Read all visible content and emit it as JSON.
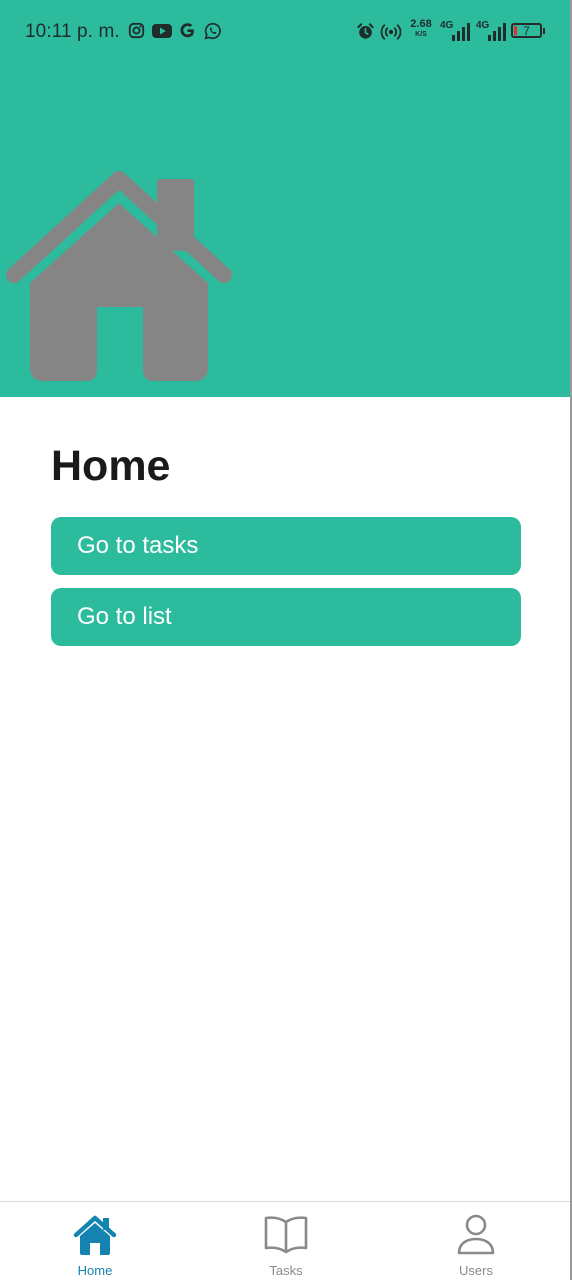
{
  "colors": {
    "accent": "#2dbb9e",
    "active_tab": "#1583b0",
    "inactive_tab": "#8a8a8a",
    "hero_icon": "#858585"
  },
  "status_bar": {
    "time": "10:11 p. m.",
    "left_icons": [
      "instagram-icon",
      "youtube-icon",
      "google-icon",
      "whatsapp-icon"
    ],
    "net_speed": "2.68",
    "net_speed_unit": "K/S",
    "network_1": "4G",
    "network_2": "4G",
    "battery_level": "7"
  },
  "hero": {
    "icon": "house-icon"
  },
  "main": {
    "title": "Home",
    "buttons": [
      {
        "label": "Go to tasks"
      },
      {
        "label": "Go to list"
      }
    ]
  },
  "bottom_nav": {
    "tabs": [
      {
        "label": "Home",
        "icon": "home-icon",
        "active": true
      },
      {
        "label": "Tasks",
        "icon": "book-icon",
        "active": false
      },
      {
        "label": "Users",
        "icon": "user-icon",
        "active": false
      }
    ]
  }
}
